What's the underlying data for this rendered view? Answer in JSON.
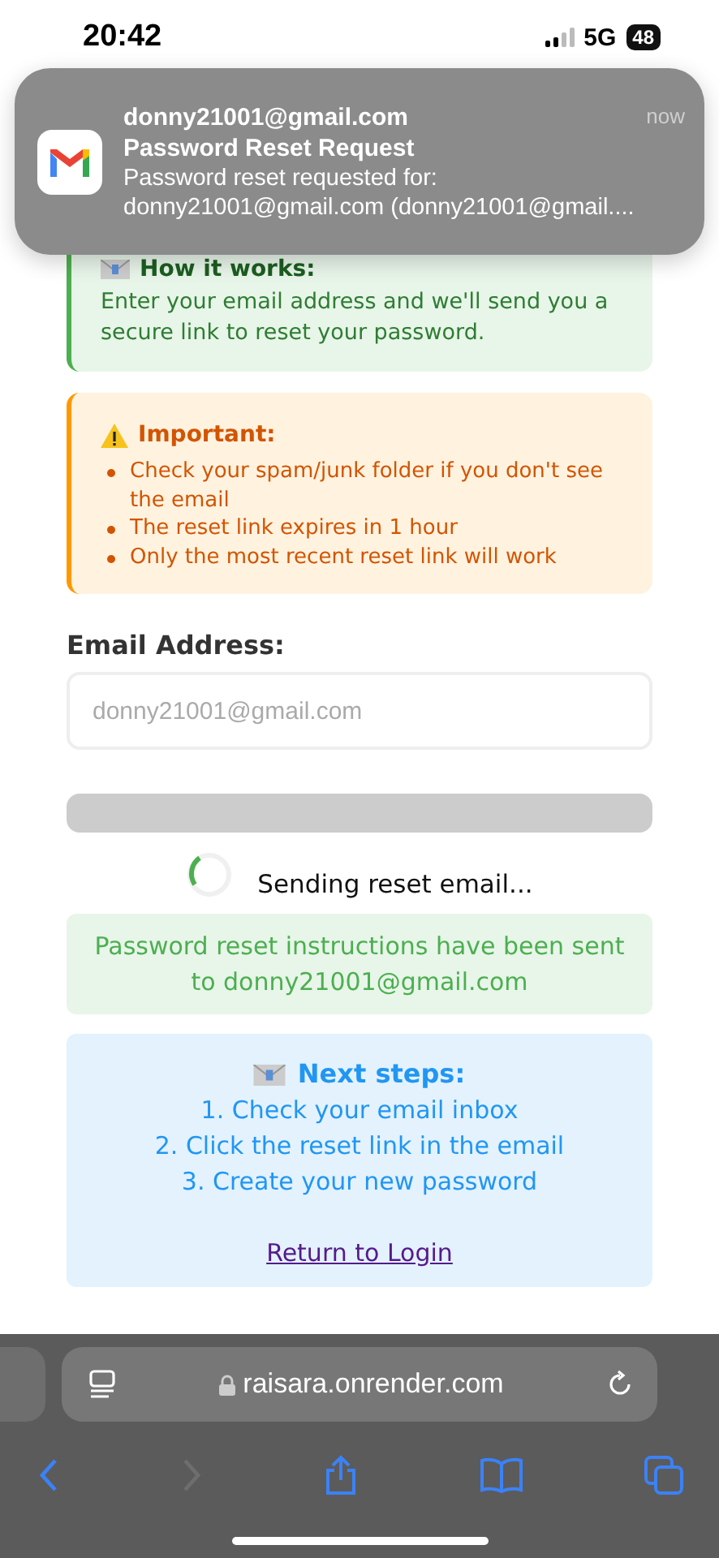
{
  "status_bar": {
    "time": "20:42",
    "network": "5G",
    "battery": "48"
  },
  "notification": {
    "sender": "donny21001@gmail.com",
    "title": "Password Reset Request",
    "body_lines": [
      "Password reset requested for:",
      "donny21001@gmail.com (donny21001@gmail...."
    ],
    "time": "now"
  },
  "info_box": {
    "title": "How it works:",
    "text": "Enter your email address and we'll send you a secure link to reset your password."
  },
  "warning_box": {
    "title": "Important:",
    "items": [
      "Check your spam/junk folder if you don't see the email",
      "The reset link expires in 1 hour",
      "Only the most recent reset link will work"
    ]
  },
  "email_field": {
    "label": "Email Address:",
    "placeholder": "donny21001@gmail.com"
  },
  "submit_button": {
    "disabled": true
  },
  "loading": {
    "text": "Sending reset email..."
  },
  "success_message": "Password reset instructions have been sent to donny21001@gmail.com",
  "next_steps": {
    "title": "Next steps:",
    "steps": [
      "1. Check your email inbox",
      "2. Click the reset link in the email",
      "3. Create your new password"
    ],
    "link": "Return to Login"
  },
  "browser": {
    "url": "raisara.onrender.com",
    "forward_disabled": true
  }
}
